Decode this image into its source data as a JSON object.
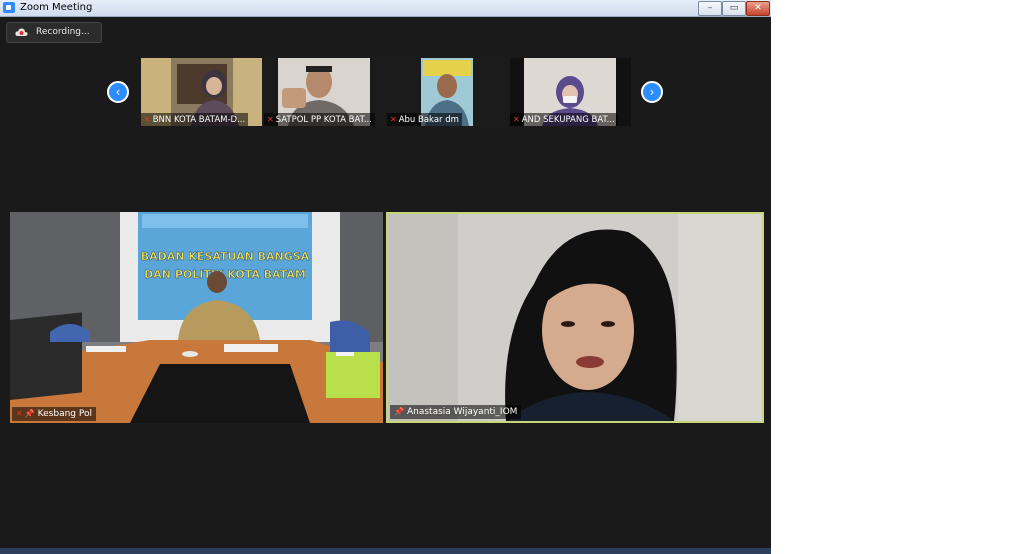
{
  "window": {
    "title": "Zoom Meeting",
    "controls": {
      "minimize": "–",
      "maximize": "▭",
      "close": "✕"
    }
  },
  "recording": {
    "label": "Recording..."
  },
  "nav": {
    "prev": "‹",
    "next": "›"
  },
  "thumbnails": [
    {
      "name": "BNN KOTA BATAM-D..."
    },
    {
      "name": "SATPOL PP KOTA BAT..."
    },
    {
      "name": "Abu Bakar dm"
    },
    {
      "name": "AND SEKUPANG BAT..."
    }
  ],
  "main_videos": [
    {
      "name": "Kesbang Pol"
    },
    {
      "name": "Anastasia Wijayanti_IOM"
    }
  ],
  "banner": {
    "line1": "BADAN KESATUAN BANGSA",
    "line2": "DAN POLITIK KOTA BATAM"
  },
  "colors": {
    "accent": "#2d8cff",
    "active_speaker_border": "#c8d67a",
    "mic_off": "#e0352b"
  }
}
